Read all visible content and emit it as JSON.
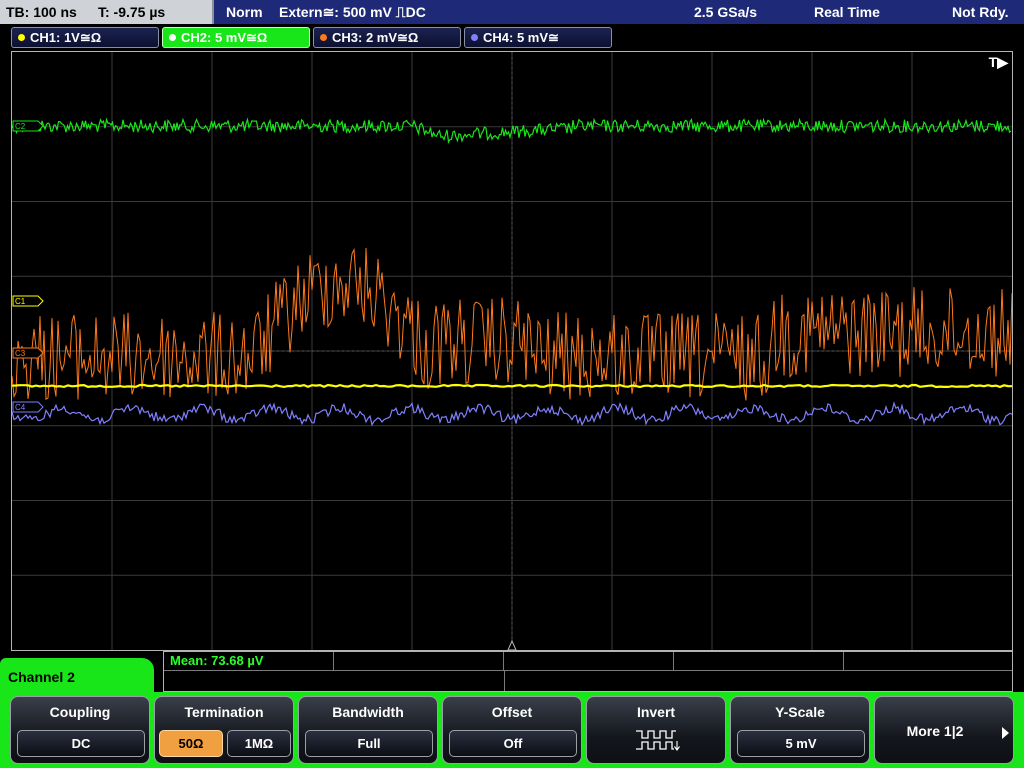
{
  "status_bar": {
    "timebase": "TB: 100 ns",
    "trigger_time": "T: -9.75 µs",
    "trigger_mode": "Norm",
    "trigger_source": "Extern≅: 500 mV ⎍DC",
    "sample_rate": "2.5 GSa/s",
    "acq_mode": "Real Time",
    "state": "Not Rdy."
  },
  "channels": [
    {
      "label": "CH1: 1V≅Ω",
      "color": "#ffff00"
    },
    {
      "label": "CH2: 5 mV≅Ω",
      "color": "#19e619"
    },
    {
      "label": "CH3: 2 mV≅Ω",
      "color": "#ff7a1a"
    },
    {
      "label": "CH4: 5 mV≅",
      "color": "#8080ff"
    }
  ],
  "screen": {
    "trigger_marker": "T▶",
    "markers": {
      "ch1": "C1",
      "ch2": "C2",
      "ch3": "C3",
      "ch4": "C4"
    }
  },
  "measurement": {
    "mean": "Mean: 73.68 µV"
  },
  "menu": {
    "channel_title": "Channel 2",
    "coupling": {
      "title": "Coupling",
      "value": "DC"
    },
    "termination": {
      "title": "Termination",
      "opt1": "50Ω",
      "opt2": "1MΩ",
      "selected": "50Ω"
    },
    "bandwidth": {
      "title": "Bandwidth",
      "value": "Full"
    },
    "offset": {
      "title": "Offset",
      "value": "Off"
    },
    "invert": {
      "title": "Invert",
      "icon": "invert-waveform-icon"
    },
    "yscale": {
      "title": "Y-Scale",
      "value": "5 mV"
    },
    "more": {
      "label": "More 1|2",
      "icon": "arrow-right-icon"
    }
  }
}
